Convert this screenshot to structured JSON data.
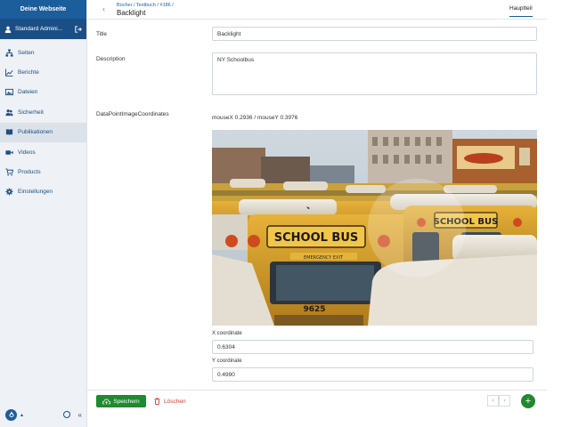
{
  "sidebar": {
    "site_title": "Deine Webseite",
    "user_name": "Standard Admini...",
    "items": [
      {
        "label": "Seiten",
        "icon": "sitemap-icon",
        "active": false
      },
      {
        "label": "Berichte",
        "icon": "chart-line-icon",
        "active": false
      },
      {
        "label": "Dateien",
        "icon": "image-icon",
        "active": false
      },
      {
        "label": "Sicherheit",
        "icon": "users-icon",
        "active": false
      },
      {
        "label": "Publikationen",
        "icon": "book-icon",
        "active": true
      },
      {
        "label": "Videos",
        "icon": "video-icon",
        "active": false
      },
      {
        "label": "Products",
        "icon": "cart-icon",
        "active": false
      },
      {
        "label": "Einstellungen",
        "icon": "gear-icon",
        "active": false
      }
    ],
    "collapse_symbol": "«"
  },
  "header": {
    "breadcrumb": "Bücher / Testbuch / #186 /",
    "title": "Backlight",
    "tab": "Hauptteil"
  },
  "form": {
    "title_label": "Title",
    "title_value": "Backlight",
    "description_label": "Description",
    "description_value": "NY Schoolbus",
    "coords_label": "DataPointImageCoordinates",
    "mouse_readout": "mouseX 0.2936 / mouseY 0.3976",
    "photo_text": {
      "bus_sign_left": "SCHOOL BUS",
      "bus_sign_right": "SCHOOL BUS",
      "emergency": "EMERGENCY EXIT",
      "bus_number": "9625"
    },
    "x_label": "X coordinate",
    "x_value": "0.6304",
    "y_label": "Y coordinate",
    "y_value": "0.4990"
  },
  "footer": {
    "save_label": "Speichern",
    "delete_label": "Löschen",
    "prev": "‹",
    "next": "›",
    "add": "+"
  },
  "colors": {
    "brand": "#1c5d9c",
    "save": "#1f8a2e",
    "delete": "#d43a2c"
  }
}
